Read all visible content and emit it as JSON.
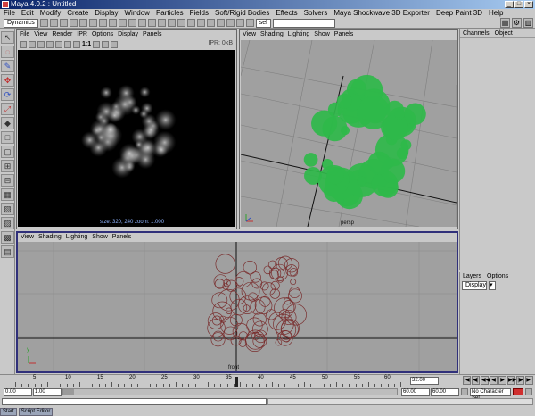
{
  "window": {
    "title": "Maya 4.0.2 : Untitled",
    "controls": [
      "_",
      "□",
      "×"
    ]
  },
  "menubar": {
    "items": [
      "File",
      "Edit",
      "Modify",
      "Create",
      "Display",
      "Window",
      "Particles",
      "Fields",
      "Soft/Rigid Bodies",
      "Effects",
      "Solvers",
      "Maya Shockwave 3D Exporter",
      "Deep Paint 3D",
      "Help"
    ]
  },
  "shelf": {
    "mode": "Dynamics",
    "selection_set": "sel",
    "field_value": ""
  },
  "render_view": {
    "menu": [
      "File",
      "View",
      "Render",
      "IPR",
      "Options",
      "Display",
      "Panels"
    ],
    "ratio": "1:1",
    "ipr_status": "IPR: 0kB",
    "status_line": "size: 320, 240 zoom: 1.000"
  },
  "persp_view": {
    "menu": [
      "View",
      "Shading",
      "Lighting",
      "Show",
      "Panels"
    ],
    "camera_label": "persp",
    "background_color": "#a0a0a0",
    "particle_color": "#2fb84a"
  },
  "front_view": {
    "menu": [
      "View",
      "Shading",
      "Lighting",
      "Show",
      "Panels"
    ],
    "camera_label": "front",
    "axis_label_y": "y",
    "particle_color": "#7a3030"
  },
  "channel_box": {
    "tabs": [
      "Channels",
      "Object"
    ]
  },
  "layer_editor": {
    "tabs": [
      "Layers",
      "Options"
    ],
    "display_mode": "Display"
  },
  "timeline": {
    "ticks": [
      "5",
      "10",
      "15",
      "20",
      "25",
      "30",
      "35",
      "40",
      "45",
      "50",
      "55",
      "60"
    ],
    "current_time": "32.00",
    "start_time": "0.00",
    "playback_start": "1.00",
    "playback_end": "60.00",
    "end_time": "60.00",
    "character_set": "No Character Set"
  },
  "taskbar": {
    "items": [
      "Start",
      "Script Editor"
    ]
  }
}
